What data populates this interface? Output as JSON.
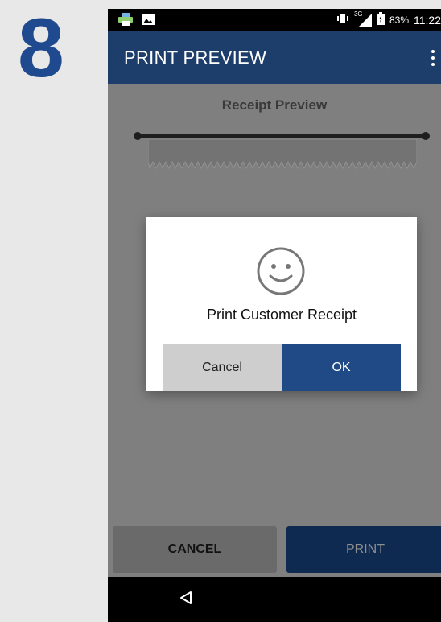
{
  "step": {
    "number": "8"
  },
  "status_bar": {
    "icons": [
      "printer-icon",
      "image-icon",
      "vibrate-icon",
      "signal-3g-icon",
      "battery-icon"
    ],
    "signal_label": "3G",
    "battery": "83%",
    "time": "11:22"
  },
  "app_bar": {
    "title": "PRINT PREVIEW",
    "menu_icon": "overflow-menu-icon"
  },
  "content": {
    "receipt_title": "Receipt Preview"
  },
  "dialog": {
    "icon": "smiley-icon",
    "message": "Print Customer Receipt",
    "cancel_label": "Cancel",
    "ok_label": "OK"
  },
  "actions": {
    "cancel_label": "CANCEL",
    "print_label": "PRINT"
  },
  "nav_bar": {
    "back_icon": "back-triangle-icon"
  },
  "colors": {
    "accent": "#1f4a8f",
    "app_bar": "#1d3d6b",
    "ok_button": "#1f4a85",
    "overlay": "#7f7f7f"
  }
}
